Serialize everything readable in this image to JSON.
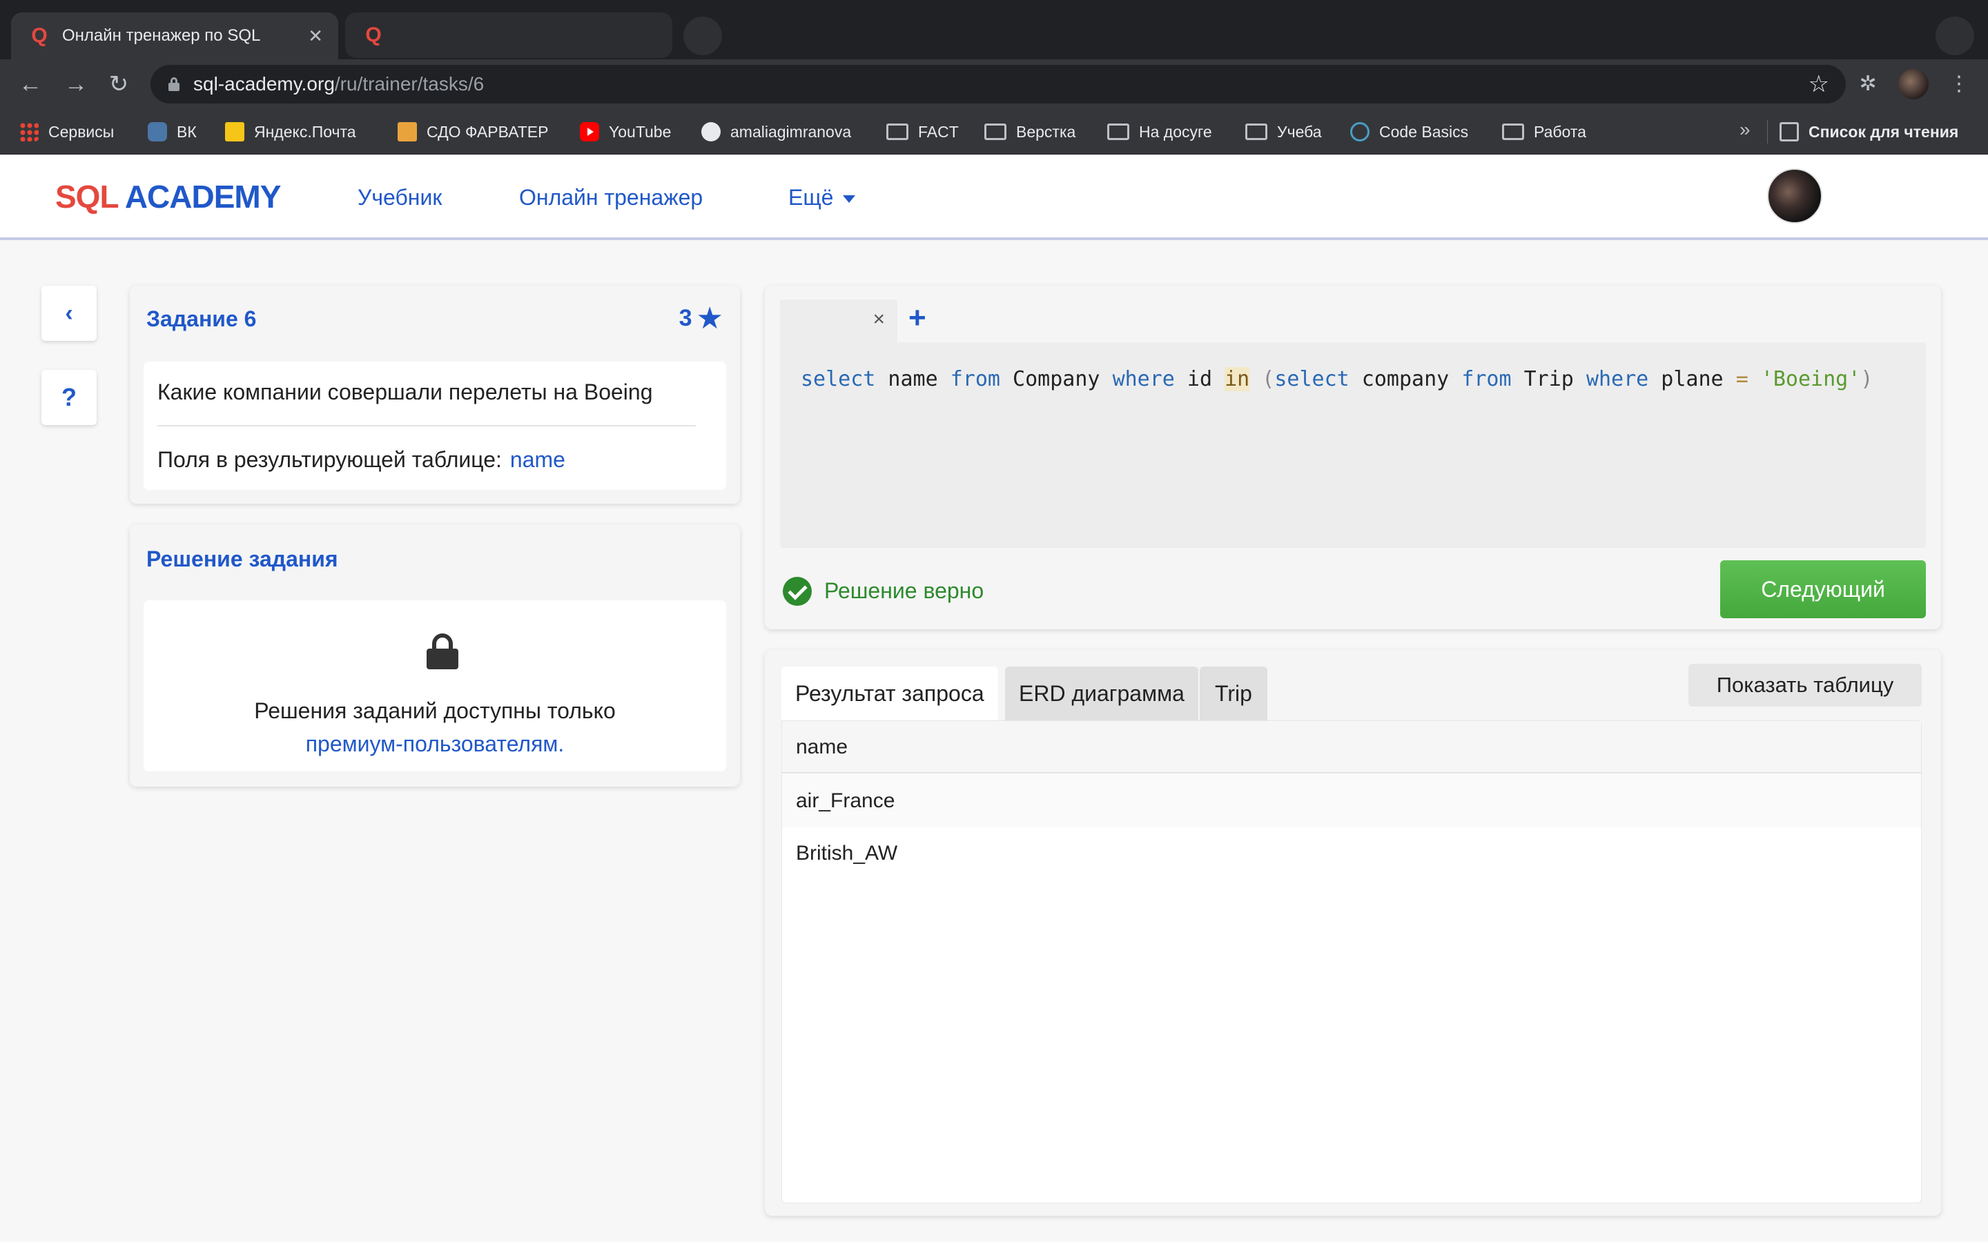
{
  "browser": {
    "active_tab_title": "Онлайн тренажер по SQL",
    "url_host": "sql-academy.org",
    "url_path": "/ru/trainer/tasks/6",
    "bookmarks": [
      "Сервисы",
      "ВК",
      "Яндекс.Почта",
      "СДО ФАРВАТЕР",
      "YouTube",
      "amaliagimranova",
      "FACT",
      "Верстка",
      "На досуге",
      "Учеба",
      "Code Basics",
      "Работа"
    ],
    "more_bookmarks": "»",
    "reading_list": "Список для чтения"
  },
  "site": {
    "logo_sql": "SQL",
    "logo_academy": "ACADEMY",
    "nav": {
      "textbook": "Учебник",
      "trainer": "Онлайн тренажер",
      "more": "Ещё"
    }
  },
  "sidebar": {
    "back_icon": "‹",
    "help_icon": "?"
  },
  "task": {
    "title": "Задание 6",
    "stars": "3",
    "question": "Какие компании совершали перелеты на Boeing",
    "fields_label": "Поля в результирующей таблице:",
    "fields_value": "name"
  },
  "solution": {
    "title": "Решение задания",
    "locked_text": "Решения заданий доступны только",
    "premium_link": "премиум-пользователям."
  },
  "editor": {
    "close_tab": "×",
    "add_tab": "+",
    "status_text": "Решение верно",
    "next_button": "Следующий",
    "query_tokens": {
      "t1": "select",
      "t2": " name ",
      "t3": "from",
      "t4": " Company ",
      "t5": "where",
      "t6": " id ",
      "t7": "in",
      "t8": " (",
      "t9": "select",
      "t10": " company ",
      "t11": "from",
      "t12": " Trip ",
      "t13": "where",
      "t14": " plane ",
      "t15": "=",
      "t16": " ",
      "t17": "'Boeing'",
      "t18": ")"
    }
  },
  "results": {
    "tabs": [
      "Результат запроса",
      "ERD диаграмма",
      "Trip"
    ],
    "show_table_button": "Показать таблицу",
    "columns": [
      "name"
    ],
    "rows": [
      "air_France",
      "British_AW"
    ]
  },
  "colors": {
    "brand_blue": "#2058c9",
    "logo_red": "#e4483f",
    "success_green": "#2d8a2d",
    "button_green": "#4fb247"
  }
}
